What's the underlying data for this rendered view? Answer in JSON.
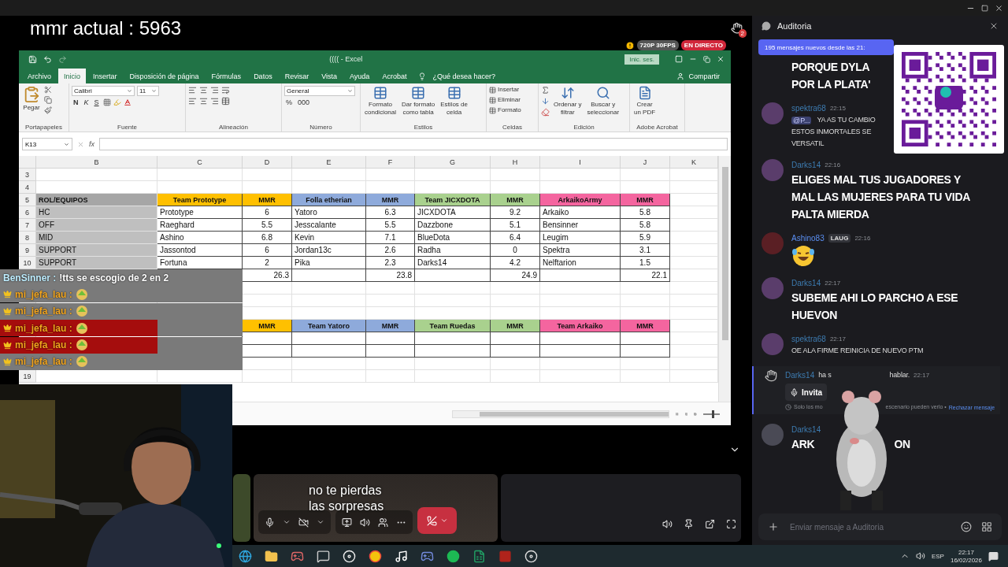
{
  "stream": {
    "overlay_text": "mmr actual : 5963",
    "raised_hands": "2",
    "quality": "720P 30FPS",
    "live": "EN DIRECTO"
  },
  "excel": {
    "title": "(((( - Excel",
    "sign_in": "Inic. ses.",
    "tabs": [
      {
        "label": "Archivo",
        "selected": false
      },
      {
        "label": "Inicio",
        "selected": true
      },
      {
        "label": "Insertar",
        "selected": false
      },
      {
        "label": "Disposición de página",
        "selected": false
      },
      {
        "label": "Fórmulas",
        "selected": false
      },
      {
        "label": "Datos",
        "selected": false
      },
      {
        "label": "Revisar",
        "selected": false
      },
      {
        "label": "Vista",
        "selected": false
      },
      {
        "label": "Ayuda",
        "selected": false
      },
      {
        "label": "Acrobat",
        "selected": false
      }
    ],
    "tell_me": "¿Qué desea hacer?",
    "share": "Compartir",
    "ribbon": {
      "clipboard": {
        "paste": "Pegar",
        "label": "Portapapeles"
      },
      "font": {
        "name": "Calibri",
        "size": "11",
        "styles": [
          "N",
          "K",
          "S"
        ],
        "label": "Fuente"
      },
      "alignment": {
        "label": "Alineación"
      },
      "number": {
        "format": "General",
        "symbols": [
          "%",
          "000"
        ],
        "label": "Número"
      },
      "styles": {
        "buttons": [
          [
            "Formato",
            "condicional"
          ],
          [
            "Dar formato",
            "como tabla"
          ],
          [
            "Estilos de",
            "celda"
          ]
        ],
        "label": "Estilos"
      },
      "cells": {
        "buttons": [
          "Insertar",
          "Eliminar",
          "Formato"
        ],
        "label": "Celdas"
      },
      "editing": {
        "buttons": [
          [
            "Ordenar y",
            "filtrar"
          ],
          [
            "Buscar y",
            "seleccionar"
          ]
        ],
        "label": "Edición"
      },
      "acrobat": {
        "buttons": [
          [
            "Crear",
            "un PDF"
          ]
        ],
        "label": "Adobe Acrobat"
      }
    },
    "name_box": "K13",
    "fx": "fx",
    "sheet": {
      "columns": [
        "B",
        "C",
        "D",
        "E",
        "F",
        "G",
        "H",
        "I",
        "J",
        "K"
      ],
      "rows": [
        {
          "number": "3",
          "kind": "blank"
        },
        {
          "number": "4",
          "kind": "blank"
        },
        {
          "number": "5",
          "kind": "header",
          "cells": {
            "B": {
              "text": "ROL/EQUIPOS",
              "color": "#a6a6a6"
            },
            "C": {
              "text": "Team Prototype",
              "color": "#ffc000"
            },
            "D": {
              "text": "MMR",
              "color": "#ffc000"
            },
            "E": {
              "text": "Folla etherian",
              "color": "#8eaadb"
            },
            "F": {
              "text": "MMR",
              "color": "#8eaadb"
            },
            "G": {
              "text": "Team JICXDOTA",
              "color": "#a9d18e"
            },
            "H": {
              "text": "MMR",
              "color": "#a9d18e"
            },
            "I": {
              "text": "ArkaikoArmy",
              "color": "#f4659f"
            },
            "J": {
              "text": "MMR",
              "color": "#f4659f"
            }
          }
        },
        {
          "number": "6",
          "kind": "data",
          "cells": {
            "B": {
              "text": "HC",
              "color": "#bfbfbf"
            },
            "C": {
              "text": "Prototype"
            },
            "D": {
              "text": "6"
            },
            "E": {
              "text": "Yatoro"
            },
            "F": {
              "text": "6.3"
            },
            "G": {
              "text": "JICXDOTA"
            },
            "H": {
              "text": "9.2"
            },
            "I": {
              "text": "Arkaiko"
            },
            "J": {
              "text": "5.8"
            }
          }
        },
        {
          "number": "7",
          "kind": "data",
          "cells": {
            "B": {
              "text": "OFF",
              "color": "#bfbfbf"
            },
            "C": {
              "text": "Raeghard"
            },
            "D": {
              "text": "5.5"
            },
            "E": {
              "text": "Jesscalante"
            },
            "F": {
              "text": "5.5"
            },
            "G": {
              "text": "Dazzbone"
            },
            "H": {
              "text": "5.1"
            },
            "I": {
              "text": "Bensinner"
            },
            "J": {
              "text": "5.8"
            }
          }
        },
        {
          "number": "8",
          "kind": "data",
          "cells": {
            "B": {
              "text": "MID",
              "color": "#bfbfbf"
            },
            "C": {
              "text": "Ashino"
            },
            "D": {
              "text": "6.8"
            },
            "E": {
              "text": "Kevin"
            },
            "F": {
              "text": "7.1"
            },
            "G": {
              "text": "BlueDota"
            },
            "H": {
              "text": "6.4"
            },
            "I": {
              "text": "Leugim"
            },
            "J": {
              "text": "5.9"
            }
          }
        },
        {
          "number": "9",
          "kind": "data",
          "cells": {
            "B": {
              "text": "SUPPORT",
              "color": "#bfbfbf"
            },
            "C": {
              "text": "Jassontod"
            },
            "D": {
              "text": "6"
            },
            "E": {
              "text": "Jordan13c"
            },
            "F": {
              "text": "2.6"
            },
            "G": {
              "text": "Radha"
            },
            "H": {
              "text": "0"
            },
            "I": {
              "text": "Spektra"
            },
            "J": {
              "text": "3.1"
            }
          }
        },
        {
          "number": "10",
          "kind": "data",
          "cells": {
            "B": {
              "text": "SUPPORT",
              "color": "#bfbfbf"
            },
            "C": {
              "text": "Fortuna"
            },
            "D": {
              "text": "2"
            },
            "E": {
              "text": "Pika"
            },
            "F": {
              "text": "2.3"
            },
            "G": {
              "text": "Darks14"
            },
            "H": {
              "text": "4.2"
            },
            "I": {
              "text": "Nelftarion"
            },
            "J": {
              "text": "1.5"
            }
          }
        },
        {
          "kind": "total",
          "cells": {
            "D": {
              "text": "26.3"
            },
            "F": {
              "text": "23.8"
            },
            "H": {
              "text": "24.9"
            },
            "J": {
              "text": "22.1"
            }
          }
        },
        {
          "kind": "blank"
        },
        {
          "kind": "blank"
        },
        {
          "kind": "blank"
        },
        {
          "kind": "header",
          "cells": {
            "D": {
              "text": "MMR",
              "color": "#ffc000"
            },
            "E": {
              "text": "Team Yatoro",
              "color": "#8eaadb"
            },
            "F": {
              "text": "MMR",
              "color": "#8eaadb"
            },
            "G": {
              "text": "Team Ruedas",
              "color": "#a9d18e"
            },
            "H": {
              "text": "MMR",
              "color": "#a9d18e"
            },
            "I": {
              "text": "Team Arkaiko",
              "color": "#f4659f"
            },
            "J": {
              "text": "MMR",
              "color": "#f4659f"
            }
          }
        },
        {
          "kind": "empty_table"
        },
        {
          "kind": "empty_table"
        },
        {
          "kind": "blank"
        },
        {
          "number": "19",
          "kind": "blank"
        }
      ]
    },
    "zoom": {
      "level": 0.55
    }
  },
  "stream_chat": [
    {
      "name": "BenSinner :",
      "color": "#bfeeff",
      "crown": false,
      "highlighted": false,
      "kind": "text",
      "text": "!tts se escogio de 2 en 2"
    },
    {
      "name": "mi_jefa_lau :",
      "color": "#f2a51e",
      "crown": true,
      "highlighted": false,
      "kind": "emote"
    },
    {
      "name": "mi_jefa_lau :",
      "color": "#f2a51e",
      "crown": true,
      "highlighted": false,
      "kind": "emote"
    },
    {
      "name": "mi_jefa_lau :",
      "color": "#f2a51e",
      "crown": true,
      "highlighted": true,
      "kind": "emote"
    },
    {
      "name": "mi_jefa_lau :",
      "color": "#f2a51e",
      "crown": true,
      "highlighted": true,
      "kind": "emote"
    },
    {
      "name": "mi_jefa_lau :",
      "color": "#f2a51e",
      "crown": true,
      "highlighted": false,
      "kind": "emote"
    }
  ],
  "subtitle": [
    "no te pierdas",
    "las sorpresas"
  ],
  "discord": {
    "channel": "Auditoria",
    "banner": "195 mensajes nuevos desde las 21:",
    "messages": [
      {
        "kind": "continuation",
        "large": true,
        "lines": [
          "PORQUE DYLA",
          "POR LA PLATA'"
        ]
      },
      {
        "kind": "message",
        "user": "spektra68",
        "color": "#3d7bb0",
        "time": "22:15",
        "mention": "@P...",
        "large": false,
        "lines": [
          "YA AS TU CAMBIO",
          "ESTOS INMORTALES SE",
          "VERSATIL"
        ]
      },
      {
        "kind": "message",
        "user": "Darks14",
        "color": "#3d7bb0",
        "time": "22:16",
        "large": true,
        "lines": [
          "ELIGES MAL TUS JUGADORES Y MAL LAS MUJERES PARA TU VIDA PALTA MIERDA"
        ]
      },
      {
        "kind": "emoji",
        "user": "Ashino83",
        "color": "#5a8ef0",
        "tag": "LAUG",
        "time": "22:16"
      },
      {
        "kind": "message",
        "user": "Darks14",
        "color": "#3d7bb0",
        "time": "22:17",
        "large": true,
        "lines": [
          "SUBEME AHI LO PARCHO A ESE HUEVON"
        ]
      },
      {
        "kind": "message",
        "user": "spektra68",
        "color": "#3d7bb0",
        "time": "22:17",
        "large": false,
        "lines": [
          "OE ALA FIRME REINICIA DE NUEVO PTM"
        ]
      },
      {
        "kind": "system",
        "user": "Darks14",
        "color": "#3d7bb0",
        "parts": [
          "ha s",
          "hablar."
        ],
        "time": "22:17",
        "button": "Invita",
        "note": [
          "Solo los mo",
          "escenario pueden verlo •"
        ],
        "link": "Rechazar mensaje"
      },
      {
        "kind": "split",
        "user": "Darks14",
        "color": "#3d7bb0",
        "parts": [
          "ARK",
          "ON"
        ]
      }
    ],
    "input_placeholder": "Enviar mensaje a Auditoria"
  },
  "tray": {
    "language": "ESP",
    "time": "22:17",
    "date": "16/02/2026"
  }
}
